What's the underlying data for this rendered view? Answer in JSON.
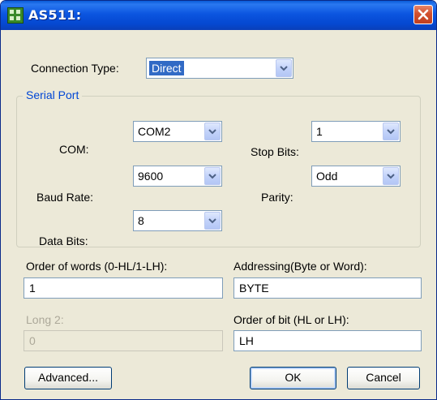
{
  "window": {
    "title": "AS511:",
    "icon": "app-icon",
    "close_icon": "close-icon"
  },
  "connection": {
    "label": "Connection Type:",
    "value": "Direct"
  },
  "serial_port": {
    "title": "Serial Port",
    "com": {
      "label": "COM:",
      "value": "COM2"
    },
    "baud_rate": {
      "label": "Baud Rate:",
      "value": "9600"
    },
    "data_bits": {
      "label": "Data Bits:",
      "value": "8"
    },
    "stop_bits": {
      "label": "Stop Bits:",
      "value": "1"
    },
    "parity": {
      "label": "Parity:",
      "value": "Odd"
    }
  },
  "order_of_words": {
    "label": "Order of words (0-HL/1-LH):",
    "value": "1"
  },
  "addressing": {
    "label": "Addressing(Byte or Word):",
    "value": "BYTE"
  },
  "long2": {
    "label": "Long 2:",
    "value": "0"
  },
  "order_of_bit": {
    "label": "Order of bit (HL or LH):",
    "value": "LH"
  },
  "buttons": {
    "advanced": "Advanced...",
    "ok": "OK",
    "cancel": "Cancel"
  },
  "colors": {
    "title_bar": "#0b55e0",
    "dialog_bg": "#ece9d8",
    "group_title": "#0046d5",
    "selection": "#316ac5",
    "close_button": "#c1401f"
  }
}
